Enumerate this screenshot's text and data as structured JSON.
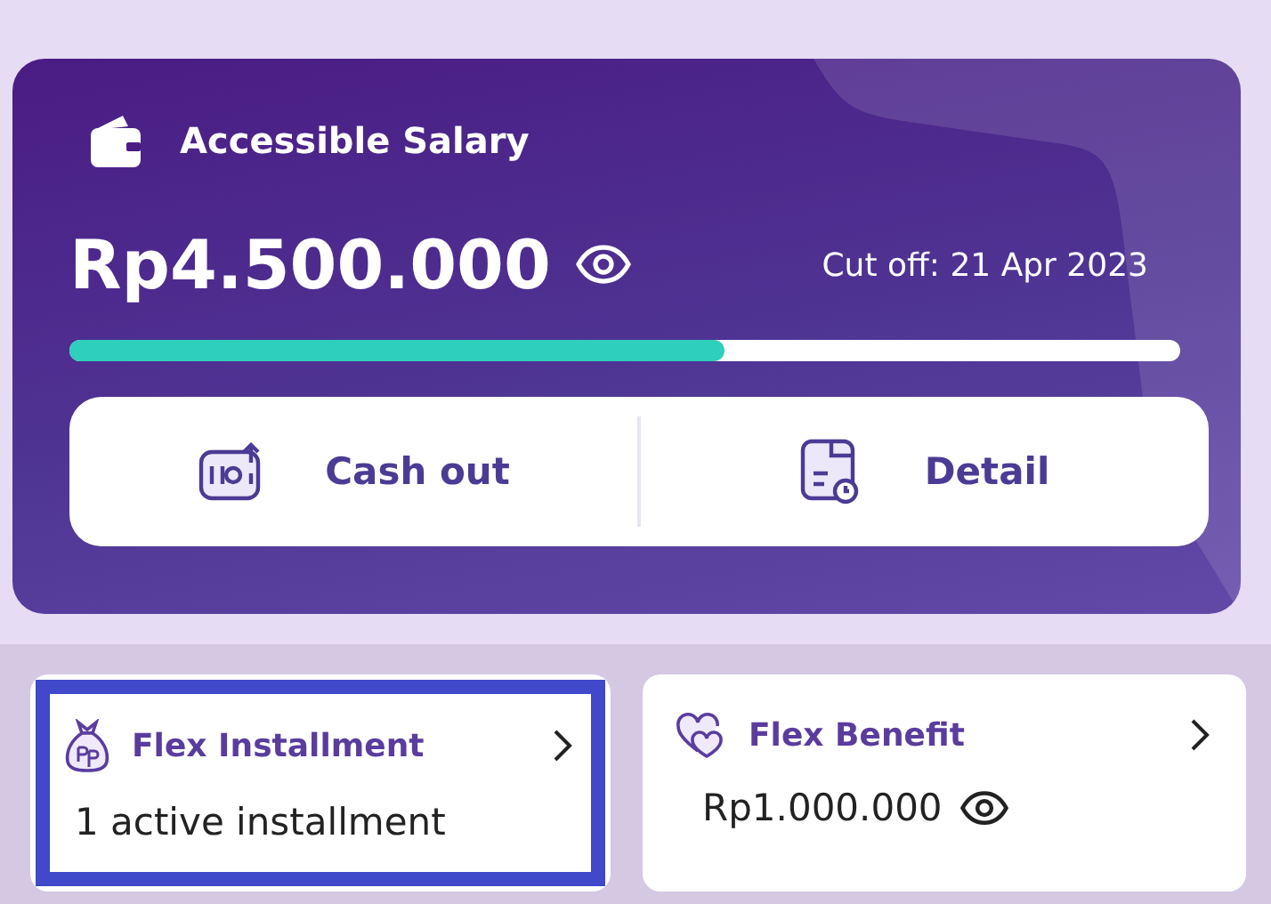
{
  "salary_card": {
    "title": "Accessible Salary",
    "amount": "Rp4.500.000",
    "cutoff": "Cut off: 21 Apr 2023",
    "level": 0.59,
    "actions": [
      {
        "kind": "cashout",
        "label": "Cash out"
      },
      {
        "kind": "detail",
        "label": "Detail"
      }
    ]
  },
  "feature_cards": [
    {
      "kind": "installment",
      "title": "Flex Installment",
      "value": "1 active installment",
      "show_eye": false,
      "selected": true
    },
    {
      "kind": "benefit",
      "title": "Flex Benefit",
      "value": "Rp1.000.000",
      "show_eye": true,
      "selected": false
    }
  ]
}
